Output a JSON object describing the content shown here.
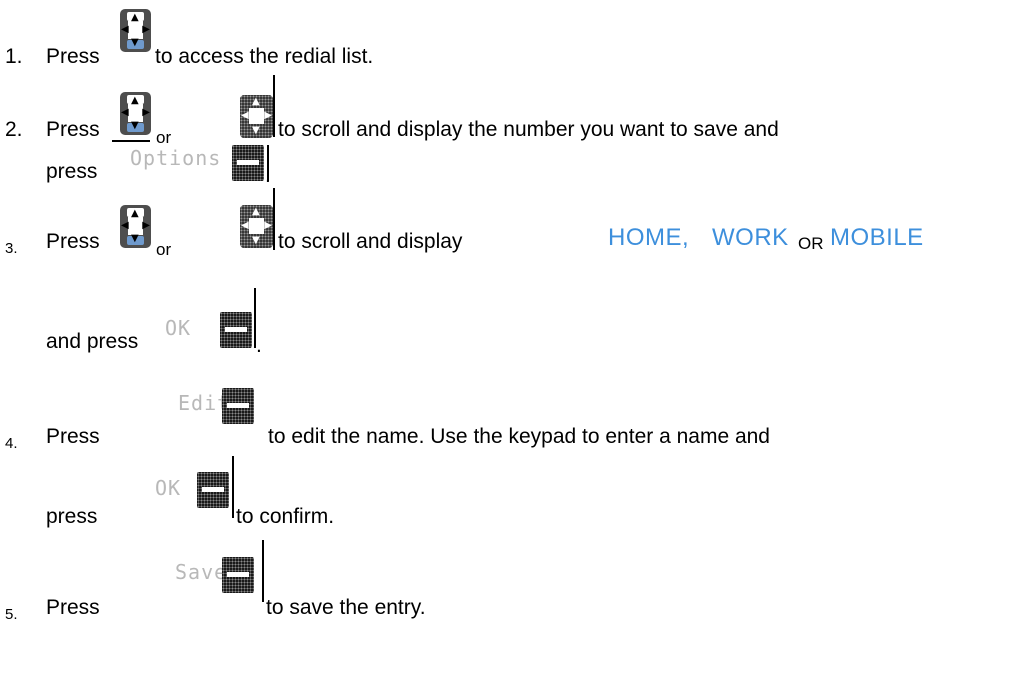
{
  "steps": [
    {
      "num": "1.",
      "press": "Press",
      "rest": "to access the redial list."
    },
    {
      "num": "2.",
      "press": "Press",
      "or": "or",
      "rest": "to scroll and display the number you want to save and",
      "press2": "press",
      "period": "."
    },
    {
      "num": "3.",
      "press": "Press",
      "or": "or",
      "rest": "to scroll and display",
      "home": "HOME,",
      "work": "WORK",
      "or_caps": "OR",
      "mobile": "MOBILE",
      "and_press": "and press",
      "period": "."
    },
    {
      "num": "4.",
      "press": "Press",
      "rest": "to edit the name.  Use the keypad to enter a name and",
      "press2": "press",
      "rest2": "to confirm."
    },
    {
      "num": "5.",
      "press": "Press",
      "rest": "to save the entry."
    }
  ],
  "softkeys": {
    "options": "Options",
    "ok": "OK",
    "edit": "Edit",
    "save": "Save"
  },
  "icons": [
    "navigation-key-icon",
    "navigation-key-dotted-icon",
    "soft-key-icon"
  ],
  "colors": {
    "accent": "#3d8fdc"
  }
}
